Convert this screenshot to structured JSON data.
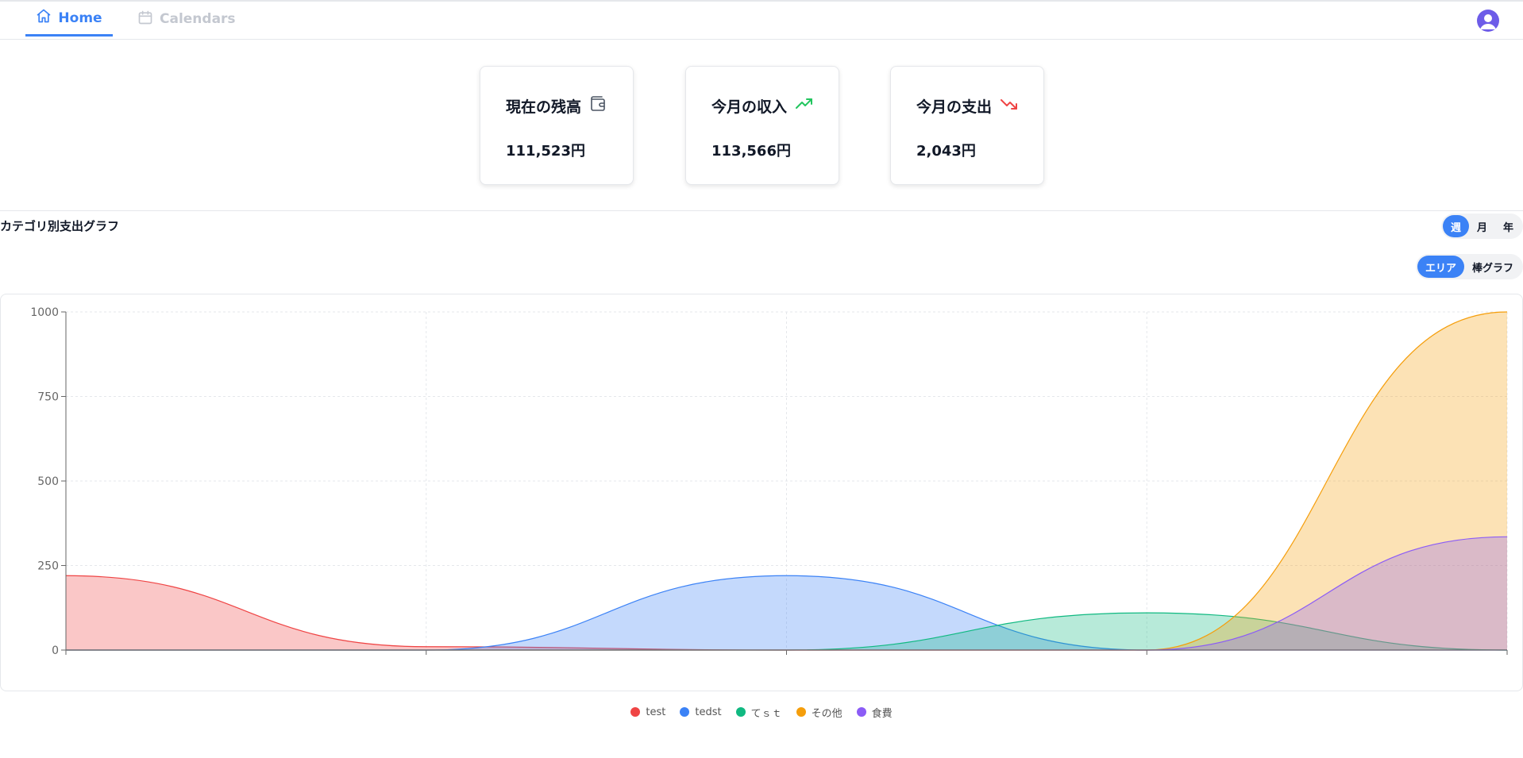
{
  "nav": {
    "home_label": "Home",
    "calendars_label": "Calendars"
  },
  "cards": {
    "balance": {
      "title": "現在の残高",
      "value": "111,523円"
    },
    "income": {
      "title": "今月の収入",
      "value": "113,566円"
    },
    "expense": {
      "title": "今月の支出",
      "value": "2,043円"
    }
  },
  "section": {
    "title": "カテゴリ別支出グラフ"
  },
  "period_toggle": {
    "options": [
      "週",
      "月",
      "年"
    ],
    "selected": "週"
  },
  "chart_kind_toggle": {
    "options": [
      "エリア",
      "棒グラフ"
    ],
    "selected": "エリア"
  },
  "colors": {
    "accent": "#3b82f6",
    "income_icon": "#22c55e",
    "expense_icon": "#ef4444"
  },
  "chart_data": {
    "type": "area",
    "x": [
      0,
      1,
      2,
      3,
      4
    ],
    "ylim": [
      0,
      1000
    ],
    "yticks": [
      0,
      250,
      500,
      750,
      1000
    ],
    "grid": true,
    "legend_position": "bottom-center",
    "series": [
      {
        "name": "test",
        "color": "#ef4444",
        "values": [
          220,
          10,
          0,
          0,
          0
        ]
      },
      {
        "name": "tedst",
        "color": "#3b82f6",
        "values": [
          0,
          0,
          220,
          0,
          0
        ]
      },
      {
        "name": "てｓｔ",
        "color": "#10b981",
        "values": [
          0,
          0,
          0,
          110,
          0
        ]
      },
      {
        "name": "その他",
        "color": "#f59e0b",
        "values": [
          0,
          0,
          0,
          0,
          1000
        ]
      },
      {
        "name": "食費",
        "color": "#8b5cf6",
        "values": [
          0,
          0,
          0,
          0,
          335
        ]
      }
    ]
  }
}
